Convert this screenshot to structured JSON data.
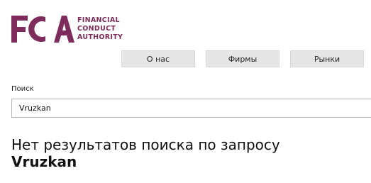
{
  "logo": {
    "letters": "FCA",
    "line1": "FINANCIAL",
    "line2": "CONDUCT",
    "line3": "AUTHORITY",
    "color": "#7e2c5b"
  },
  "nav": {
    "items": [
      {
        "label": "О нас"
      },
      {
        "label": "Фирмы"
      },
      {
        "label": "Рынки"
      }
    ]
  },
  "search": {
    "label": "Поиск",
    "value": "Vruzkan"
  },
  "results": {
    "heading": "Нет результатов поиска по запросу",
    "query": "Vruzkan"
  }
}
